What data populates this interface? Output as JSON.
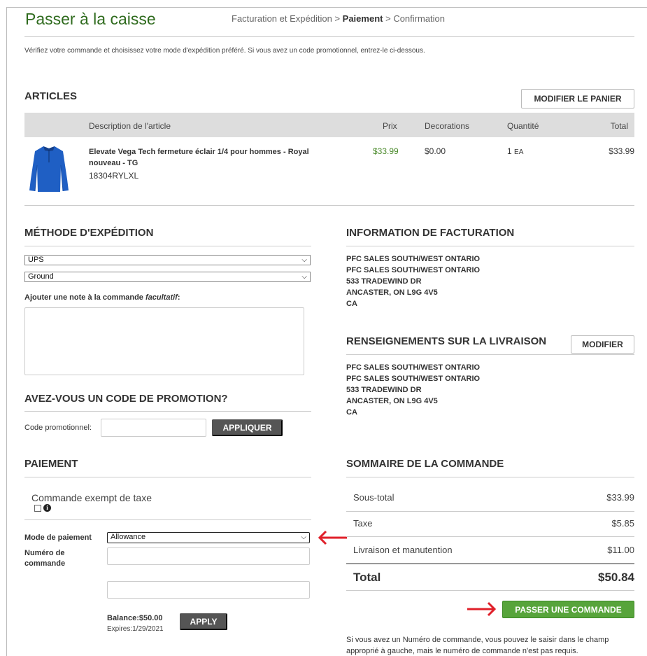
{
  "header": {
    "title": "Passer à la caisse",
    "crumb_billing": "Facturation et Expédition",
    "crumb_sep1": ">",
    "crumb_payment": "Paiement",
    "crumb_sep2": ">",
    "crumb_confirm": "Confirmation"
  },
  "intro": "Vérifiez votre commande et choisissez votre mode d'expédition préféré. Si vous avez un code promotionnel, entrez-le ci-dessous.",
  "articles": {
    "heading": "ARTICLES",
    "edit_cart": "MODIFIER LE PANIER",
    "columns": {
      "description": "Description de l'article",
      "price": "Prix",
      "decorations": "Decorations",
      "quantity": "Quantité",
      "total": "Total"
    },
    "item": {
      "name_line1": "Elevate Vega Tech fermeture éclair 1/4 pour hommes - Royal",
      "name_line2": "nouveau - TG",
      "sku": "18304RYLXL",
      "price": "$33.99",
      "decorations": "$0.00",
      "qty": "1",
      "unit": "EA",
      "total": "$33.99"
    }
  },
  "shipping_method": {
    "heading": "MÉTHODE D'EXPÉDITION",
    "carrier": "UPS",
    "service": "Ground",
    "note_label": "Ajouter une note à la commande",
    "note_optional": "facultatif",
    "note_colon": ":"
  },
  "promo": {
    "heading": "AVEZ-VOUS UN CODE DE PROMOTION?",
    "label": "Code promotionnel:",
    "apply": "APPLIQUER"
  },
  "payment": {
    "heading": "PAIEMENT",
    "tax_exempt": "Commande exempt de taxe",
    "info_glyph": "i",
    "method_label": "Mode de paiement",
    "method_value": "Allowance",
    "order_number_label_1": "Numéro de",
    "order_number_label_2": "commande",
    "balance": "Balance:$50.00",
    "expires": "Expires:1/29/2021",
    "apply": "APPLY"
  },
  "billing": {
    "heading": "INFORMATION DE FACTURATION",
    "lines": [
      "PFC SALES SOUTH/WEST ONTARIO",
      "PFC SALES SOUTH/WEST ONTARIO",
      "533 TRADEWIND DR",
      "ANCASTER, ON L9G 4V5",
      "CA"
    ]
  },
  "delivery": {
    "heading": "RENSEIGNEMENTS SUR LA LIVRAISON",
    "edit": "MODIFIER",
    "lines": [
      "PFC SALES SOUTH/WEST ONTARIO",
      "PFC SALES SOUTH/WEST ONTARIO",
      "533 TRADEWIND DR",
      "ANCASTER, ON L9G 4V5",
      "CA"
    ]
  },
  "summary": {
    "heading": "SOMMAIRE DE LA COMMANDE",
    "subtotal_label": "Sous-total",
    "subtotal": "$33.99",
    "tax_label": "Taxe",
    "tax": "$5.85",
    "shipping_label": "Livraison et manutention",
    "shipping": "$11.00",
    "total_label": "Total",
    "total": "$50.84",
    "place_order": "PASSER UNE COMMANDE",
    "note_line1": "Si vous avez un Numéro de commande, vous pouvez le saisir dans le champ",
    "note_line2": "approprié à gauche, mais le numéro de commande n'est pas requis."
  },
  "colors": {
    "brand_green": "#2f6b1e",
    "button_green": "#57a43b",
    "arrow_red": "#e0202a",
    "price_green": "#4a8a2a"
  }
}
